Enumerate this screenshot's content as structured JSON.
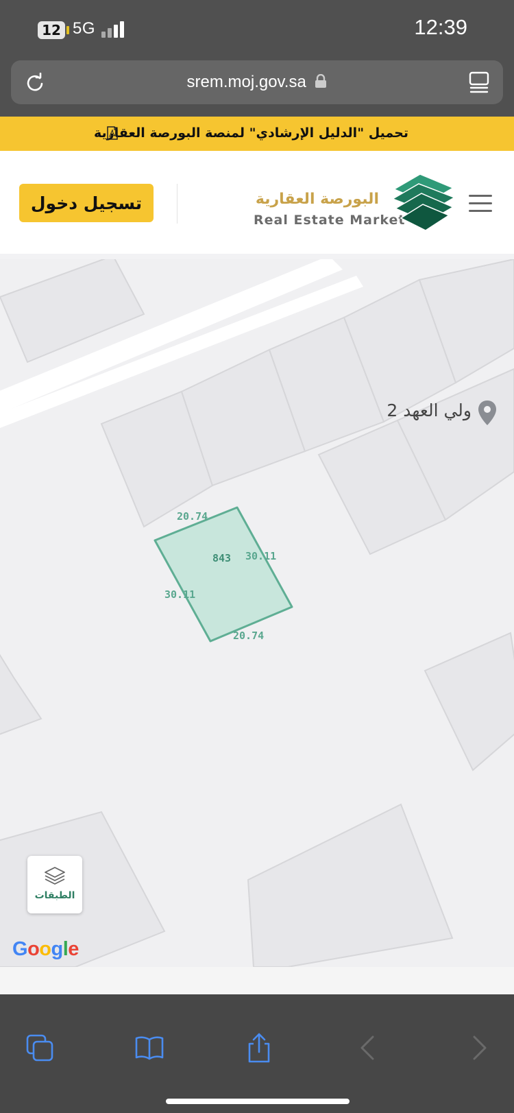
{
  "status_bar": {
    "battery": "12",
    "network": "5G",
    "time": "12:39"
  },
  "browser": {
    "url": "srem.moj.gov.sa"
  },
  "banner": {
    "text": "تحميل \"الدليل الإرشادي\" لمنصة البورصة العقارية"
  },
  "header": {
    "login_label": "تسجيل دخول",
    "brand_ar": "البورصة العقارية",
    "brand_en": "Real Estate Market"
  },
  "map": {
    "poi_label": "ولي العهد 2",
    "parcel": {
      "id": "843",
      "top_side": "20.74",
      "right_side": "30.11",
      "left_side": "30.11",
      "bottom_side": "20.74"
    },
    "layers_label": "الطبقات",
    "google_letters": [
      "G",
      "o",
      "o",
      "g",
      "l",
      "e"
    ]
  },
  "colors": {
    "accent_yellow": "#f6c530",
    "brand_green": "#1f7a5c",
    "brand_gold": "#c8a24a",
    "parcel_fill": "#c8e6dc",
    "parcel_stroke": "#5fae94",
    "ios_blue": "#4a8cf0"
  },
  "icons": {
    "reload": "reload-icon",
    "lock": "lock-icon",
    "reader": "reader-icon",
    "pdf": "pdf-icon",
    "menu": "hamburger-icon",
    "pin": "poi-pin-icon",
    "layers": "layers-icon",
    "tabs": "tabs-icon",
    "bookmarks": "bookmarks-icon",
    "share": "share-icon",
    "back": "back-icon",
    "forward": "forward-icon"
  }
}
